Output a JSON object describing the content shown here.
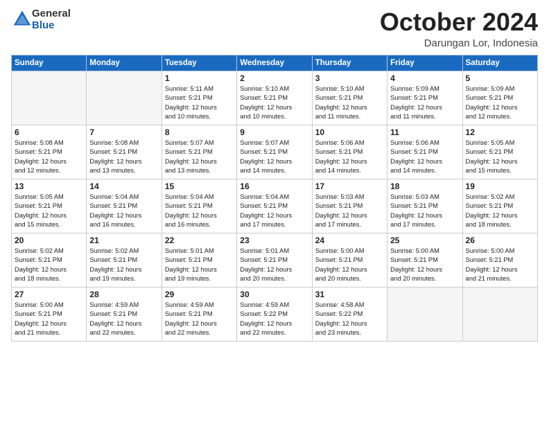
{
  "logo": {
    "general": "General",
    "blue": "Blue"
  },
  "header": {
    "month": "October 2024",
    "location": "Darungan Lor, Indonesia"
  },
  "weekdays": [
    "Sunday",
    "Monday",
    "Tuesday",
    "Wednesday",
    "Thursday",
    "Friday",
    "Saturday"
  ],
  "weeks": [
    [
      {
        "day": "",
        "empty": true
      },
      {
        "day": "",
        "empty": true
      },
      {
        "day": "1",
        "sunrise": "5:11 AM",
        "sunset": "5:21 PM",
        "daylight": "12 hours and 10 minutes."
      },
      {
        "day": "2",
        "sunrise": "5:10 AM",
        "sunset": "5:21 PM",
        "daylight": "12 hours and 10 minutes."
      },
      {
        "day": "3",
        "sunrise": "5:10 AM",
        "sunset": "5:21 PM",
        "daylight": "12 hours and 11 minutes."
      },
      {
        "day": "4",
        "sunrise": "5:09 AM",
        "sunset": "5:21 PM",
        "daylight": "12 hours and 11 minutes."
      },
      {
        "day": "5",
        "sunrise": "5:09 AM",
        "sunset": "5:21 PM",
        "daylight": "12 hours and 12 minutes."
      }
    ],
    [
      {
        "day": "6",
        "sunrise": "5:08 AM",
        "sunset": "5:21 PM",
        "daylight": "12 hours and 12 minutes."
      },
      {
        "day": "7",
        "sunrise": "5:08 AM",
        "sunset": "5:21 PM",
        "daylight": "12 hours and 13 minutes."
      },
      {
        "day": "8",
        "sunrise": "5:07 AM",
        "sunset": "5:21 PM",
        "daylight": "12 hours and 13 minutes."
      },
      {
        "day": "9",
        "sunrise": "5:07 AM",
        "sunset": "5:21 PM",
        "daylight": "12 hours and 14 minutes."
      },
      {
        "day": "10",
        "sunrise": "5:06 AM",
        "sunset": "5:21 PM",
        "daylight": "12 hours and 14 minutes."
      },
      {
        "day": "11",
        "sunrise": "5:06 AM",
        "sunset": "5:21 PM",
        "daylight": "12 hours and 14 minutes."
      },
      {
        "day": "12",
        "sunrise": "5:05 AM",
        "sunset": "5:21 PM",
        "daylight": "12 hours and 15 minutes."
      }
    ],
    [
      {
        "day": "13",
        "sunrise": "5:05 AM",
        "sunset": "5:21 PM",
        "daylight": "12 hours and 15 minutes."
      },
      {
        "day": "14",
        "sunrise": "5:04 AM",
        "sunset": "5:21 PM",
        "daylight": "12 hours and 16 minutes."
      },
      {
        "day": "15",
        "sunrise": "5:04 AM",
        "sunset": "5:21 PM",
        "daylight": "12 hours and 16 minutes."
      },
      {
        "day": "16",
        "sunrise": "5:04 AM",
        "sunset": "5:21 PM",
        "daylight": "12 hours and 17 minutes."
      },
      {
        "day": "17",
        "sunrise": "5:03 AM",
        "sunset": "5:21 PM",
        "daylight": "12 hours and 17 minutes."
      },
      {
        "day": "18",
        "sunrise": "5:03 AM",
        "sunset": "5:21 PM",
        "daylight": "12 hours and 17 minutes."
      },
      {
        "day": "19",
        "sunrise": "5:02 AM",
        "sunset": "5:21 PM",
        "daylight": "12 hours and 18 minutes."
      }
    ],
    [
      {
        "day": "20",
        "sunrise": "5:02 AM",
        "sunset": "5:21 PM",
        "daylight": "12 hours and 18 minutes."
      },
      {
        "day": "21",
        "sunrise": "5:02 AM",
        "sunset": "5:21 PM",
        "daylight": "12 hours and 19 minutes."
      },
      {
        "day": "22",
        "sunrise": "5:01 AM",
        "sunset": "5:21 PM",
        "daylight": "12 hours and 19 minutes."
      },
      {
        "day": "23",
        "sunrise": "5:01 AM",
        "sunset": "5:21 PM",
        "daylight": "12 hours and 20 minutes."
      },
      {
        "day": "24",
        "sunrise": "5:00 AM",
        "sunset": "5:21 PM",
        "daylight": "12 hours and 20 minutes."
      },
      {
        "day": "25",
        "sunrise": "5:00 AM",
        "sunset": "5:21 PM",
        "daylight": "12 hours and 20 minutes."
      },
      {
        "day": "26",
        "sunrise": "5:00 AM",
        "sunset": "5:21 PM",
        "daylight": "12 hours and 21 minutes."
      }
    ],
    [
      {
        "day": "27",
        "sunrise": "5:00 AM",
        "sunset": "5:21 PM",
        "daylight": "12 hours and 21 minutes."
      },
      {
        "day": "28",
        "sunrise": "4:59 AM",
        "sunset": "5:21 PM",
        "daylight": "12 hours and 22 minutes."
      },
      {
        "day": "29",
        "sunrise": "4:59 AM",
        "sunset": "5:21 PM",
        "daylight": "12 hours and 22 minutes."
      },
      {
        "day": "30",
        "sunrise": "4:59 AM",
        "sunset": "5:22 PM",
        "daylight": "12 hours and 22 minutes."
      },
      {
        "day": "31",
        "sunrise": "4:58 AM",
        "sunset": "5:22 PM",
        "daylight": "12 hours and 23 minutes."
      },
      {
        "day": "",
        "empty": true
      },
      {
        "day": "",
        "empty": true
      }
    ]
  ]
}
